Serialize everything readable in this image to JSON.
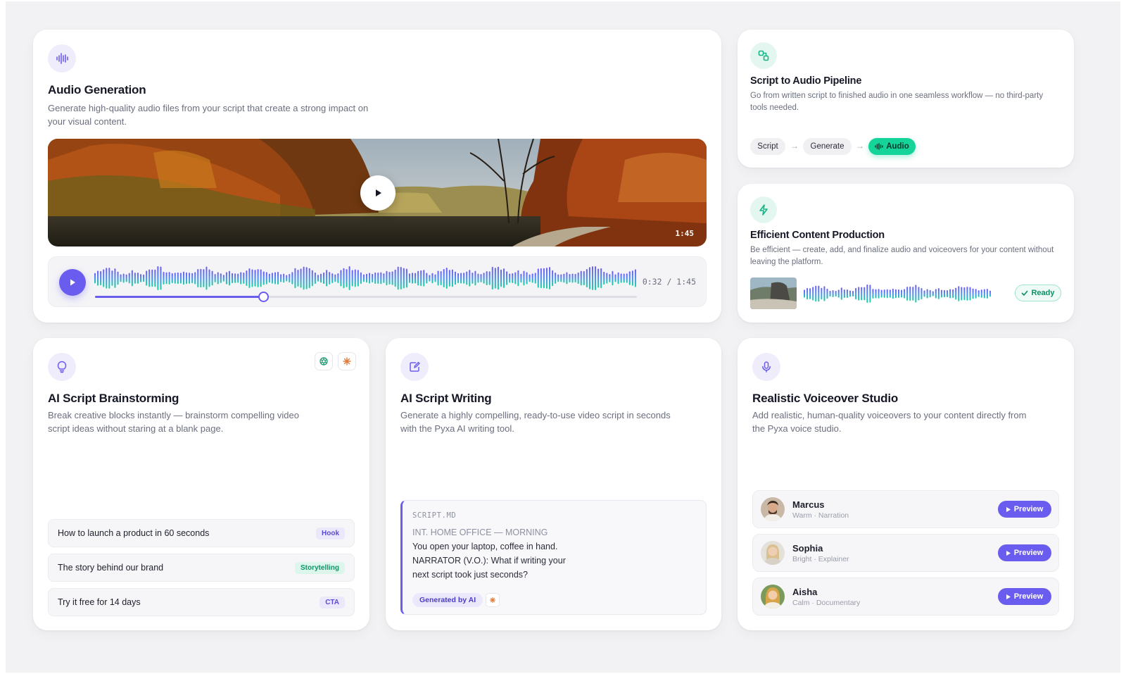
{
  "audio_generation": {
    "title": "Audio Generation",
    "description": "Generate high-quality audio files from your script that create a strong impact on your visual content.",
    "video_duration": "1:45",
    "player_time": "0:32 / 1:45",
    "progress": 0.31,
    "icon": "waveform-icon"
  },
  "pipeline": {
    "title": "Script to Audio Pipeline",
    "description": "Go from written script to finished audio in one seamless workflow — no third-party tools needed.",
    "steps": [
      "Script",
      "Generate",
      "Audio"
    ],
    "arrow": "→",
    "icon": "pipeline-icon"
  },
  "efficient": {
    "title": "Efficient Content Production",
    "description": "Be efficient — create, add, and finalize audio and voiceovers for your content without leaving the platform.",
    "status": "Ready",
    "icon": "lightning-icon"
  },
  "brainstorm": {
    "title": "AI Script Brainstorming",
    "description": "Break creative blocks instantly — brainstorm compelling video script ideas without staring at a blank page.",
    "ideas": [
      {
        "text": "How to launch a product in 60 seconds",
        "tag": "Hook"
      },
      {
        "text": "The story behind our brand",
        "tag": "Storytelling"
      },
      {
        "text": "Try it free for 14 days",
        "tag": "CTA"
      }
    ],
    "icon": "lightbulb-icon"
  },
  "script_writing": {
    "title": "AI Script Writing",
    "description": "Generate a highly compelling, ready-to-use video script in seconds with the Pyxa AI writing tool.",
    "file": "SCRIPT.MD",
    "lines": [
      "INT. HOME OFFICE — MORNING",
      "You open your laptop, coffee in hand.",
      "NARRATOR (V.O.): What if writing your",
      "next script took just seconds?"
    ],
    "generated_tag": "Generated by AI",
    "icon": "edit-document-icon"
  },
  "voiceover": {
    "title": "Realistic Voiceover Studio",
    "description": "Add realistic, human-quality voiceovers to your content directly from the Pyxa voice studio.",
    "voices": [
      {
        "name": "Marcus",
        "sub": "Warm · Narration",
        "button": "Preview"
      },
      {
        "name": "Sophia",
        "sub": "Bright · Explainer",
        "button": "Preview"
      },
      {
        "name": "Aisha",
        "sub": "Calm · Documentary",
        "button": "Preview"
      }
    ],
    "icon": "microphone-icon"
  },
  "colors": {
    "accent": "#6b5cf0",
    "mint": "#14d49a",
    "background": "#f2f2f4"
  }
}
